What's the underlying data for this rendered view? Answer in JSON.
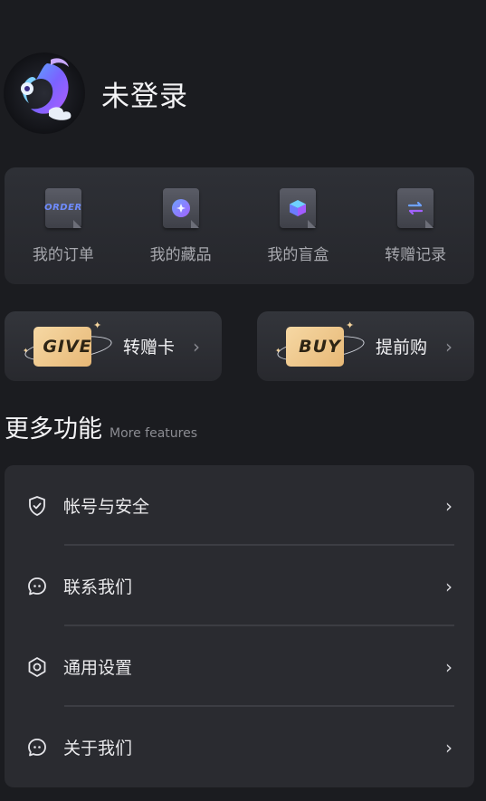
{
  "profile": {
    "username": "未登录"
  },
  "quick_actions": [
    {
      "label": "我的订单",
      "icon": "order-icon",
      "icon_text": "ORDER"
    },
    {
      "label": "我的藏品",
      "icon": "collection-icon"
    },
    {
      "label": "我的盲盒",
      "icon": "blind-box-icon"
    },
    {
      "label": "转赠记录",
      "icon": "transfer-record-icon"
    }
  ],
  "promos": {
    "give": {
      "badge": "GIVE",
      "label": "转赠卡",
      "chevron": "›"
    },
    "buy": {
      "badge": "BUY",
      "label": "提前购",
      "chevron": "›"
    }
  },
  "more_features": {
    "title_cn": "更多功能",
    "title_en": "More features",
    "items": [
      {
        "label": "帐号与安全",
        "icon": "shield-check-icon"
      },
      {
        "label": "联系我们",
        "icon": "contact-icon"
      },
      {
        "label": "通用设置",
        "icon": "settings-hexagon-icon"
      },
      {
        "label": "关于我们",
        "icon": "about-icon"
      }
    ],
    "chevron": "›"
  },
  "colors": {
    "background": "#1b1c20",
    "panel": "#2a2b30",
    "badge_gold": "#f6d8a4",
    "accent_blue": "#6f8cff",
    "accent_purple": "#9b6cff"
  }
}
